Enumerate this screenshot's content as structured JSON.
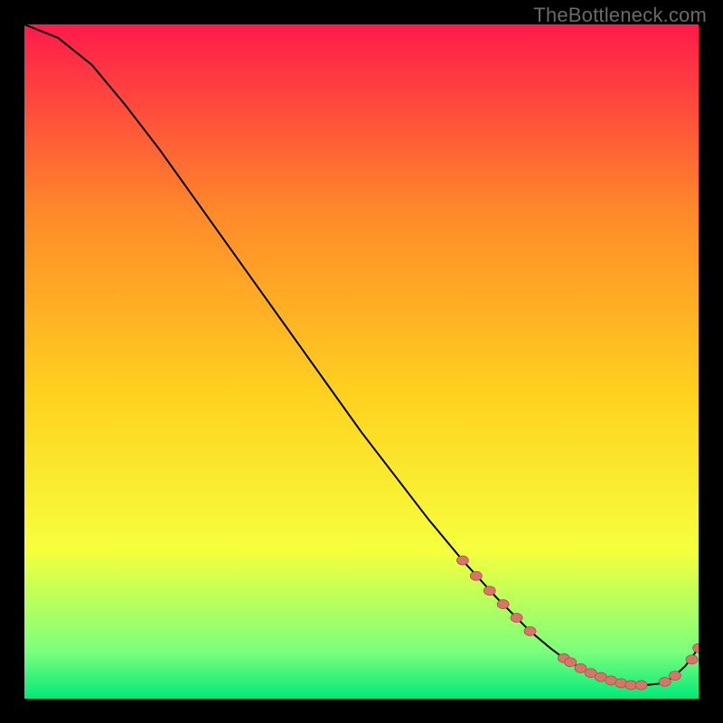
{
  "watermark": "TheBottleneck.com",
  "colors": {
    "gradient_top": "#ff1a4b",
    "gradient_mid_upper": "#ff8a2a",
    "gradient_mid": "#ffd21f",
    "gradient_mid_lower": "#f6ff3d",
    "gradient_near_bottom": "#7cff7c",
    "gradient_bottom": "#00e97a",
    "curve": "#000000",
    "marker_fill": "#d9746a",
    "marker_stroke": "#b05048",
    "background": "#000000"
  },
  "chart_data": {
    "type": "line",
    "title": "",
    "xlabel": "",
    "ylabel": "",
    "xlim": [
      0,
      100
    ],
    "ylim": [
      0,
      100
    ],
    "grid": false,
    "legend": false,
    "series": [
      {
        "name": "bottleneck-curve",
        "x": [
          0,
          5,
          10,
          15,
          20,
          25,
          30,
          35,
          40,
          45,
          50,
          55,
          60,
          65,
          70,
          75,
          78,
          80,
          82,
          84,
          86,
          88,
          90,
          92,
          94,
          96,
          98,
          100
        ],
        "y": [
          100,
          98,
          94,
          88,
          81.5,
          74.5,
          67.5,
          60.5,
          53.5,
          46.5,
          39.5,
          33,
          26.5,
          20.5,
          15,
          10,
          7.5,
          6,
          4.8,
          3.8,
          3,
          2.4,
          2,
          2,
          2.2,
          3,
          4.8,
          7.5
        ]
      }
    ],
    "markers": [
      {
        "name": "highlight-descent-1",
        "x": 65,
        "y": 20.5
      },
      {
        "name": "highlight-descent-2",
        "x": 67,
        "y": 18.2
      },
      {
        "name": "highlight-descent-3",
        "x": 69,
        "y": 16.0
      },
      {
        "name": "highlight-descent-4",
        "x": 71,
        "y": 14.0
      },
      {
        "name": "highlight-descent-5",
        "x": 73,
        "y": 12.0
      },
      {
        "name": "highlight-descent-6",
        "x": 75,
        "y": 10.0
      },
      {
        "name": "flat-1",
        "x": 80,
        "y": 6.0
      },
      {
        "name": "flat-2",
        "x": 81,
        "y": 5.4
      },
      {
        "name": "flat-3",
        "x": 82.5,
        "y": 4.5
      },
      {
        "name": "flat-4",
        "x": 84,
        "y": 3.8
      },
      {
        "name": "flat-5",
        "x": 85.5,
        "y": 3.2
      },
      {
        "name": "flat-6",
        "x": 87,
        "y": 2.7
      },
      {
        "name": "flat-7",
        "x": 88.5,
        "y": 2.3
      },
      {
        "name": "flat-8",
        "x": 90,
        "y": 2.0
      },
      {
        "name": "flat-9",
        "x": 91.5,
        "y": 2.0
      },
      {
        "name": "rise-1",
        "x": 95,
        "y": 2.5
      },
      {
        "name": "rise-2",
        "x": 96.5,
        "y": 3.4
      },
      {
        "name": "rise-3",
        "x": 99,
        "y": 5.8
      },
      {
        "name": "rise-4",
        "x": 100,
        "y": 7.5
      }
    ]
  }
}
